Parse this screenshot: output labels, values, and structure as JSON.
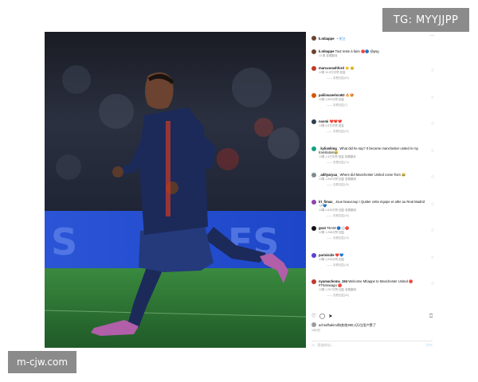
{
  "watermarks": {
    "top": "TG: MYYJJPP",
    "bottom": "m-cjw.com"
  },
  "header": {
    "username": "k.mbappe",
    "follow": "• 关注",
    "more": "···"
  },
  "caption": {
    "username": "k.mbappe",
    "text": "Tout reste à faire 🔴🔵 @psg",
    "meta": "13 周   查看翻译"
  },
  "comments": [
    {
      "username": "marcusrashford",
      "text": "👏 😢",
      "meta": "13周   10.8万次赞   回复",
      "replies": "—— 查看回复(60)",
      "avatar_color": "#c0392b"
    },
    {
      "username": "paliinsanelxra92",
      "text": "🔥🤩",
      "meta": "13周   1,693次赞   回复",
      "replies": "—— 查看回复(7)",
      "avatar_color": "#d35400"
    },
    {
      "username": "naomi",
      "text": "❤️❤️❤️",
      "meta": "13周   5.6万次赞   回复",
      "replies": "—— 查看回复(20)",
      "avatar_color": "#2c3e50"
    },
    {
      "username": "_kylianking_",
      "text": "What did he say? It became manchester united in my translation😂",
      "meta": "13周   1.4万次赞   回复   查看翻译",
      "replies": "—— 查看回复(21)",
      "avatar_color": "#16a085"
    },
    {
      "username": "_adityaryaa_",
      "text": "Where did Manchester United come from 😂",
      "meta": "13周   1,540次赞   回复   查看翻译",
      "replies": "—— 查看回复(25)",
      "avatar_color": "#7f8c8d"
    },
    {
      "username": "lrt_fimax_",
      "text": "Joue beaucoup ! Quitter cette équipe et aller au Real Madrid 🤍💙",
      "meta": "13周   4,633次赞   回复   查看翻译",
      "replies": "—— 查看回复(43)",
      "avatar_color": "#8e44ad"
    },
    {
      "username": "goat",
      "text": "TEAM 🔵⚪🔴",
      "meta": "13周   1,256次赞   回复",
      "replies": "—— 查看回复(23)",
      "avatar_color": "#111111"
    },
    {
      "username": "parisiside",
      "text": "❤️💙",
      "meta": "13周   1,049次赞   回复",
      "replies": "—— 查看回复(18)",
      "avatar_color": "#5d3fd3"
    },
    {
      "username": "nyamachoma_194",
      "text": "Welcome Mbappe to Manchester United 🔴 #Thelewago 🔴",
      "meta": "13周   1,207次赞   回复   查看翻译",
      "replies": "—— 查看回复(60)",
      "avatar_color": "#c0392b"
    }
  ],
  "actions": {
    "like_icon": "heart-icon",
    "comment_icon": "comment-icon",
    "share_icon": "send-icon",
    "save_icon": "bookmark-icon"
  },
  "likes": {
    "text": "achrafhakimi和其他390.2万位用户赞了"
  },
  "date": "1月9日",
  "add_comment": {
    "placeholder": "添加评论...",
    "post": "发布"
  },
  "colors": {
    "psg_navy": "#1c2a5a",
    "pitch_green": "#2f7a3a",
    "board_blue": "#1e4fd8",
    "follow_blue": "#3897f0"
  }
}
